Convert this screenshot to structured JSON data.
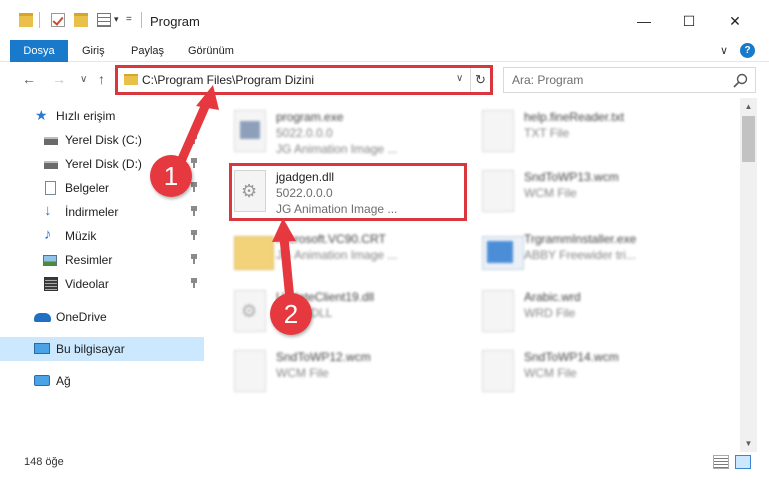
{
  "window": {
    "title": "Program",
    "minimize": "—",
    "maximize": "☐",
    "close": "✕"
  },
  "quick_access": {
    "customize": "="
  },
  "ribbon": {
    "tabs": [
      "Dosya",
      "Giriş",
      "Paylaş",
      "Görünüm"
    ],
    "expand": "∨",
    "help": "?"
  },
  "nav": {
    "back": "←",
    "forward": "→",
    "recent": "∨",
    "up": "↑"
  },
  "address": {
    "path": "C:\\Program Files\\Program Dizini",
    "dropdown": "∨",
    "refresh": "↻"
  },
  "search": {
    "placeholder": "Ara: Program"
  },
  "sidebar": {
    "items": [
      {
        "label": "Hızlı erişim",
        "icon": "star-icon"
      },
      {
        "label": "Yerel Disk (C:)",
        "icon": "drive-icon"
      },
      {
        "label": "Yerel Disk (D:)",
        "icon": "drive-icon"
      },
      {
        "label": "Belgeler",
        "icon": "documents-icon"
      },
      {
        "label": "İndirmeler",
        "icon": "download-icon"
      },
      {
        "label": "Müzik",
        "icon": "music-icon"
      },
      {
        "label": "Resimler",
        "icon": "pictures-icon"
      },
      {
        "label": "Videolar",
        "icon": "videos-icon"
      },
      {
        "label": "OneDrive",
        "icon": "cloud-icon"
      },
      {
        "label": "Bu bilgisayar",
        "icon": "computer-icon"
      },
      {
        "label": "Ağ",
        "icon": "network-icon"
      }
    ]
  },
  "files": {
    "left": [
      {
        "name": "program.exe",
        "line1": "5022.0.0.0",
        "line2": "JG Animation Image ..."
      },
      {
        "name": "jgadgen.dll",
        "line1": "5022.0.0.0",
        "line2": "JG Animation Image ..."
      },
      {
        "name": "Microsoft.VC90.CRT",
        "line1": "JG Animation Image ..."
      },
      {
        "name": "UpdateClient19.dll",
        "line1": "Office DLL"
      },
      {
        "name": "SndToWP12.wcm",
        "line1": "WCM File"
      }
    ],
    "right": [
      {
        "name": "help.fineReader.txt",
        "line1": "TXT File"
      },
      {
        "name": "SndToWP13.wcm",
        "line1": "WCM File"
      },
      {
        "name": "TrgrammInstaller.exe",
        "line1": "ABBY Freewider tri..."
      },
      {
        "name": "Arabic.wrd",
        "line1": "WRD File"
      },
      {
        "name": "SndToWP14.wcm",
        "line1": "WCM File"
      }
    ]
  },
  "status": {
    "count": "148 öğe"
  },
  "callouts": [
    "1",
    "2"
  ],
  "colors": {
    "accent": "#1979ca",
    "highlight": "#d9363e",
    "callout": "#e6393f",
    "selected": "#cce8ff"
  }
}
